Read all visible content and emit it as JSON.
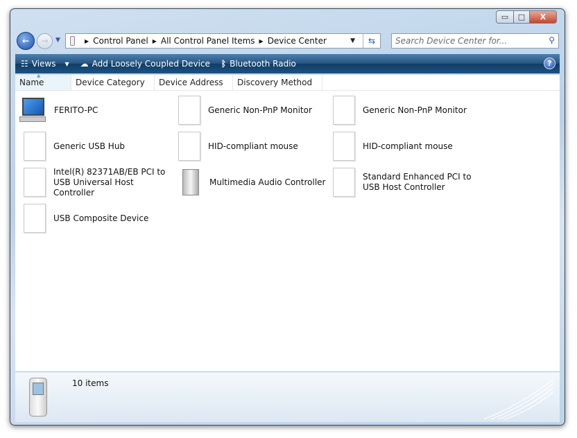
{
  "window": {
    "minimize": "▭",
    "maximize": "□",
    "close": "X"
  },
  "address": {
    "crumbs": [
      "Control Panel",
      "All Control Panel Items",
      "Device Center"
    ]
  },
  "search": {
    "placeholder": "Search Device Center for..."
  },
  "toolbar": {
    "views": "Views",
    "add": "Add Loosely Coupled Device",
    "bluetooth": "Bluetooth Radio",
    "help": "?"
  },
  "columns": [
    "Name",
    "Device Category",
    "Device Address",
    "Discovery Method"
  ],
  "items": [
    {
      "label": "FERITO-PC",
      "icon": "computer-icon"
    },
    {
      "label": "Generic Non-PnP Monitor",
      "icon": "document-icon"
    },
    {
      "label": "Generic Non-PnP Monitor",
      "icon": "document-icon"
    },
    {
      "label": "Generic USB Hub",
      "icon": "document-icon"
    },
    {
      "label": "HID-compliant mouse",
      "icon": "document-icon"
    },
    {
      "label": "HID-compliant mouse",
      "icon": "document-icon"
    },
    {
      "label": "Intel(R) 82371AB/EB PCI to USB Universal Host Controller",
      "icon": "document-icon"
    },
    {
      "label": "Multimedia Audio Controller",
      "icon": "speaker-icon"
    },
    {
      "label": "Standard Enhanced PCI to USB Host Controller",
      "icon": "document-icon"
    },
    {
      "label": "USB Composite Device",
      "icon": "document-icon"
    }
  ],
  "status": {
    "count": "10 items"
  }
}
